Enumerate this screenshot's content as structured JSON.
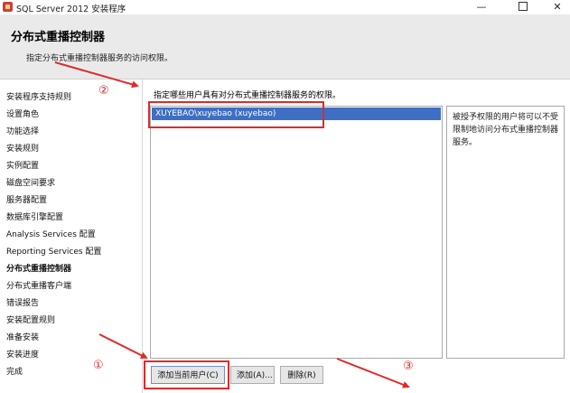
{
  "window": {
    "title": "SQL Server 2012 安装程序",
    "minimize_glyph": "—",
    "close_glyph": "✕"
  },
  "header": {
    "title": "分布式重播控制器",
    "subtitle": "指定分布式重播控制器服务的访问权限。"
  },
  "sidebar": {
    "items": [
      {
        "label": "安装程序支持规则"
      },
      {
        "label": "设置角色"
      },
      {
        "label": "功能选择"
      },
      {
        "label": "安装规则"
      },
      {
        "label": "实例配置"
      },
      {
        "label": "磁盘空间要求"
      },
      {
        "label": "服务器配置"
      },
      {
        "label": "数据库引擎配置"
      },
      {
        "label": "Analysis Services 配置"
      },
      {
        "label": "Reporting Services 配置"
      },
      {
        "label": "分布式重播控制器",
        "active": true
      },
      {
        "label": "分布式重播客户端"
      },
      {
        "label": "错误报告"
      },
      {
        "label": "安装配置规则"
      },
      {
        "label": "准备安装"
      },
      {
        "label": "安装进度"
      },
      {
        "label": "完成"
      }
    ]
  },
  "main": {
    "description": "指定哪些用户具有对分布式重播控制器服务的权限。",
    "users": [
      "XUYEBAO\\xuyebao (xuyebao)"
    ],
    "info_text": "被授予权限的用户将可以不受限制地访问分布式重播控制器服务。"
  },
  "buttons": {
    "add_current_user": "添加当前用户(C)",
    "add": "添加(A)...",
    "remove": "删除(R)"
  },
  "annotations": {
    "marker_1": "①",
    "marker_2": "②",
    "marker_3": "③",
    "color": "#e02a2a"
  }
}
